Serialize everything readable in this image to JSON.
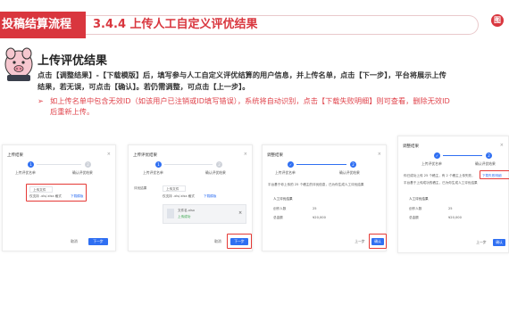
{
  "header": {
    "section_label": "投稿结算流程",
    "title": "3.4.4 上传人工自定义评优结果",
    "logo_text": "图"
  },
  "content": {
    "heading": "上传评优结果",
    "paragraph_line1": "点击【调整结果】-【下载模版】后，填写参与人工自定义评优结算的用户信息，并上传名单，点击【下一步】，平台将展示上传",
    "paragraph_line2": "结果，若无误，可点击【确认】。若仍需调整，可点击【上一步】。",
    "note_line1": "如上传名单中包含无效ID（如该用户已注销或ID填写错误），系统将自动识别，点击【下载失败明细】则可查看，删除无效ID",
    "note_line2": "后重新上传。",
    "bullet": "➢"
  },
  "panels": [
    {
      "title": "上传结果",
      "close": "×",
      "step1": "上传评优名单",
      "step2": "确认评优结果",
      "upload_btn": "上传文件",
      "hint": "仅支持 .xls/.xlsx 格式",
      "download_link": "下载模版",
      "cancel": "取消",
      "next": "下一步"
    },
    {
      "title": "上传评优结果",
      "close": "×",
      "step1": "上传评优名单",
      "step2": "确认评优结果",
      "field_label": "评优结果",
      "upload_btn": "上传文件",
      "hint": "仅支持 .xls/.xlsx 格式",
      "download_link": "下载模版",
      "file_name": "文件名.xlsx",
      "file_status": "上传成功",
      "cancel": "取消",
      "next": "下一步"
    },
    {
      "title": "调整结果",
      "close": "×",
      "step1": "上传评优名单",
      "step2": "确认评优结果",
      "summary": "平台基于你上传的 25 个稿主的评优信息，已为你生成人工评优结果",
      "table_title": "人工评优结果",
      "row1_label": "创作人数",
      "row1_value": "25",
      "row2_label": "总金额",
      "row2_value": "¥20,000",
      "prev": "上一步",
      "confirm": "确认"
    },
    {
      "title": "调整结果",
      "close": "×",
      "step1": "上传评优名单",
      "step2": "确认评优结果",
      "summary": "你已成功上传 25 个稿主，有 2 个稿主上传失败，",
      "fail_link": "下载失败明细",
      "summary2": "平台基于上传成功的稿主，已为你生成人工评优结果",
      "table_title": "人工评优结果",
      "row1_label": "创作人数",
      "row1_value": "25",
      "row2_label": "总金额",
      "row2_value": "¥20,000",
      "prev": "上一步",
      "confirm": "确认"
    }
  ],
  "colors": {
    "brand_red": "#d9363e",
    "primary_blue": "#2f6ff2",
    "highlight_red": "#e53935"
  }
}
